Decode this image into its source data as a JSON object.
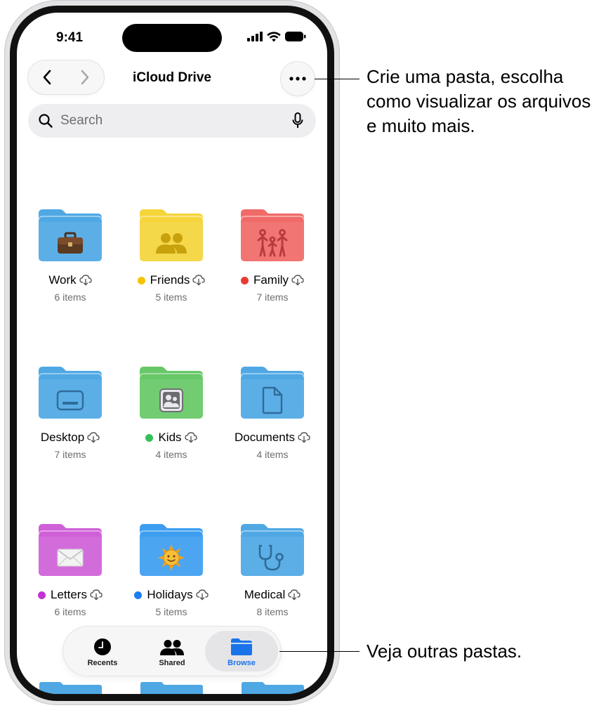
{
  "status_bar": {
    "time": "9:41"
  },
  "header": {
    "title": "iCloud Drive"
  },
  "search": {
    "placeholder": "Search"
  },
  "folders": [
    {
      "name": "Work",
      "count": "6 items",
      "tag_color": null,
      "folder_color": "#4fa8e4",
      "glyph": "briefcase-icon"
    },
    {
      "name": "Friends",
      "count": "5 items",
      "tag_color": "#f5c400",
      "folder_color": "#f5d53a",
      "glyph": "people-icon"
    },
    {
      "name": "Family",
      "count": "7 items",
      "tag_color": "#ea3a35",
      "folder_color": "#f06a68",
      "glyph": "family-icon"
    },
    {
      "name": "Desktop",
      "count": "7 items",
      "tag_color": null,
      "folder_color": "#4fa8e4",
      "glyph": "desktop-icon"
    },
    {
      "name": "Kids",
      "count": "4 items",
      "tag_color": "#33c05a",
      "folder_color": "#67c867",
      "glyph": "contact-card-icon"
    },
    {
      "name": "Documents",
      "count": "4 items",
      "tag_color": null,
      "folder_color": "#4fa8e4",
      "glyph": "document-icon"
    },
    {
      "name": "Letters",
      "count": "6 items",
      "tag_color": "#c233d4",
      "folder_color": "#d060d8",
      "glyph": "envelope-icon"
    },
    {
      "name": "Holidays",
      "count": "5 items",
      "tag_color": "#1a7ef5",
      "folder_color": "#3d9ef0",
      "glyph": "sun-icon"
    },
    {
      "name": "Medical",
      "count": "8 items",
      "tag_color": null,
      "folder_color": "#4fa8e4",
      "glyph": "stethoscope-icon"
    }
  ],
  "tabbar": {
    "tabs": [
      {
        "label": "Recents",
        "icon": "clock-icon",
        "active": false
      },
      {
        "label": "Shared",
        "icon": "people-icon",
        "active": false
      },
      {
        "label": "Browse",
        "icon": "folder-icon",
        "active": true
      }
    ],
    "accent": "#1a73e8"
  },
  "callouts": {
    "more_menu": "Crie uma pasta, escolha como visualizar os arquivos e muito mais.",
    "tabbar": "Veja outras pastas."
  }
}
